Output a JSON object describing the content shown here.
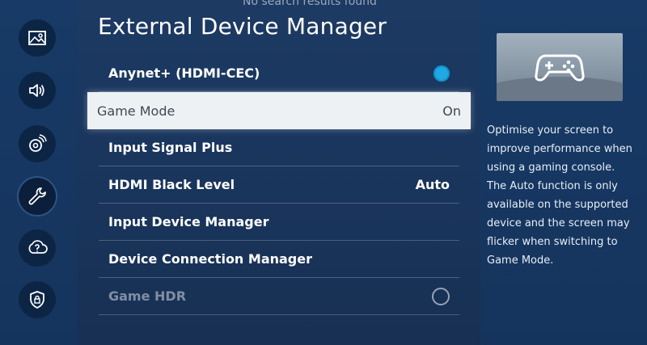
{
  "top_note": "No search results found",
  "title": "External Device Manager",
  "sidebar": {
    "items": [
      {
        "icon": "picture-icon"
      },
      {
        "icon": "sound-icon"
      },
      {
        "icon": "connection-icon"
      },
      {
        "icon": "wrench-icon",
        "active": true
      },
      {
        "icon": "support-icon"
      },
      {
        "icon": "shield-icon"
      }
    ]
  },
  "menu": {
    "items": [
      {
        "label": "Anynet+ (HDMI-CEC)",
        "toggle": "on"
      },
      {
        "label": "Game Mode",
        "value": "On",
        "selected": true
      },
      {
        "label": "Input Signal Plus"
      },
      {
        "label": "HDMI Black Level",
        "value": "Auto"
      },
      {
        "label": "Input Device Manager"
      },
      {
        "label": "Device Connection Manager"
      },
      {
        "label": "Game HDR",
        "toggle": "off",
        "disabled": true
      }
    ]
  },
  "help": {
    "preview_icon": "gamepad-icon",
    "text": "Optimise your screen to improve performance when using a gaming console. The Auto function is only available on the supported device and the screen may flicker when switching to Game Mode."
  },
  "colors": {
    "background": "#1a355c",
    "accent_toggle": "#1ea8e6",
    "selected_row": "#eef1f4"
  }
}
